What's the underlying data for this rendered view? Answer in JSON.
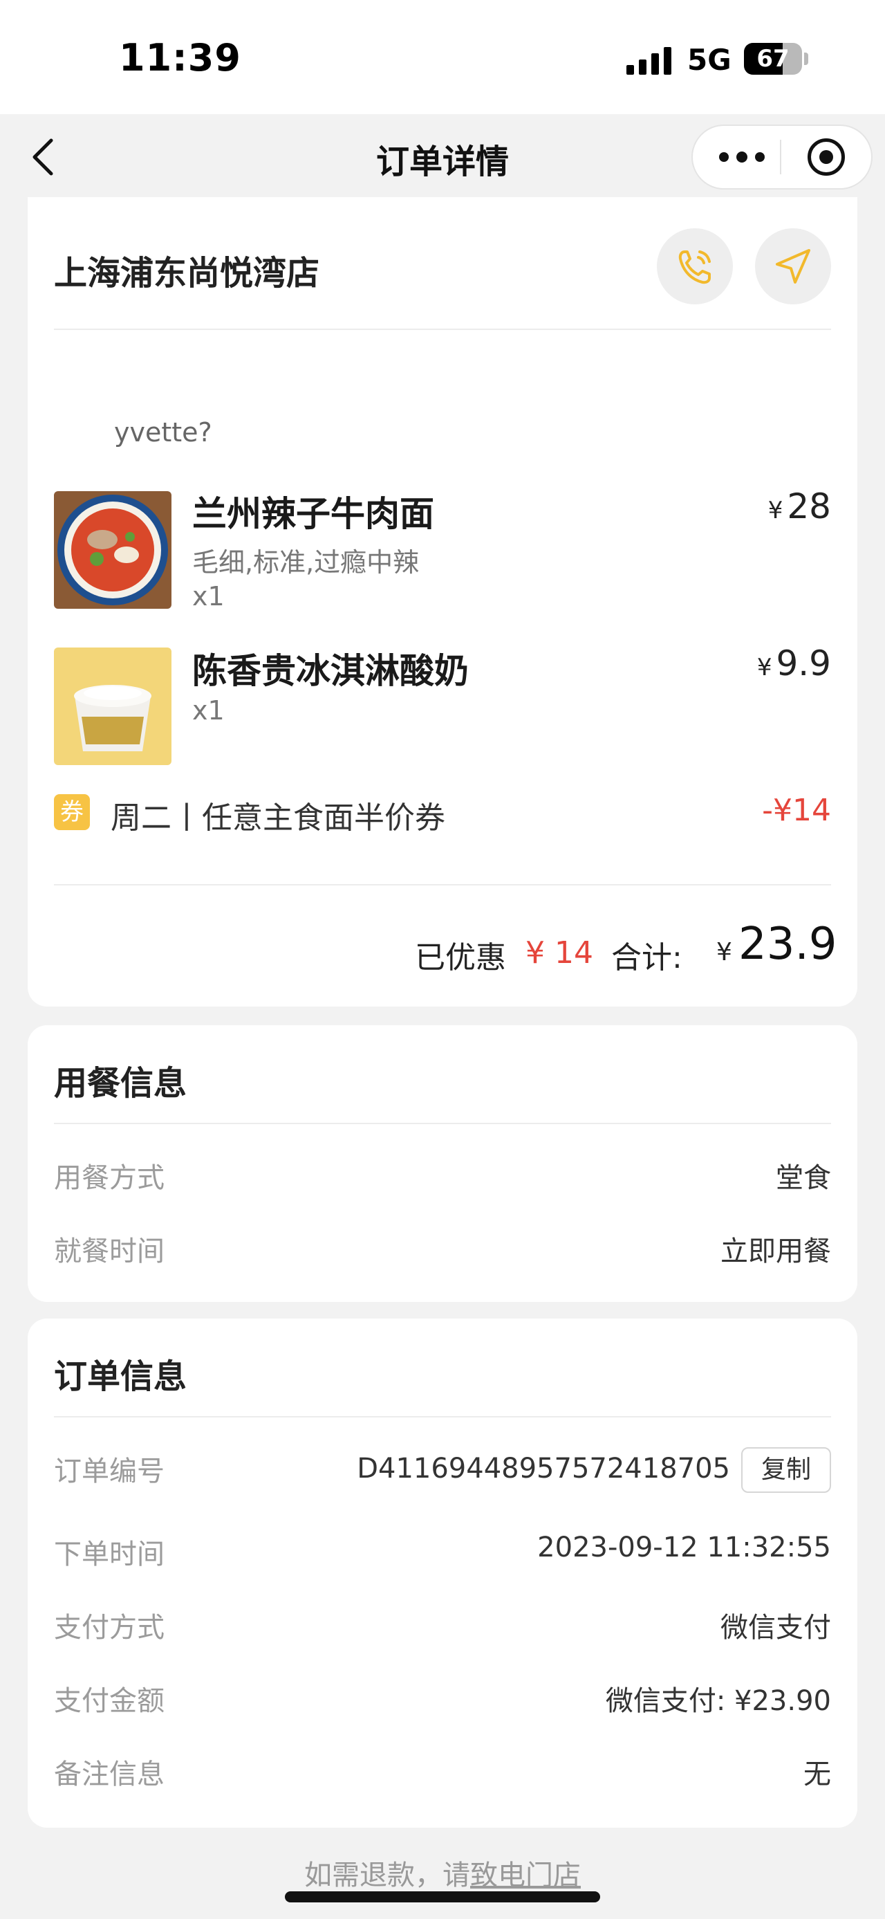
{
  "status_bar": {
    "time": "11:39",
    "network": "5G",
    "battery": "67",
    "battery_level": 0.67
  },
  "nav": {
    "title": "订单详情",
    "back_icon": "chevron-left-icon",
    "more_icon": "more-dots-icon",
    "target_icon": "target-icon"
  },
  "store": {
    "name": "上海浦东尚悦湾店",
    "phone_icon": "phone-icon",
    "navigate_icon": "navigation-arrow-icon",
    "accent_color": "#f7c344"
  },
  "order": {
    "nickname": "yvette?",
    "items": [
      {
        "name": "兰州辣子牛肉面",
        "spec": "毛细,标准,过瘾中辣",
        "qty": "x1",
        "currency": "¥",
        "price": "28"
      },
      {
        "name": "陈香贵冰淇淋酸奶",
        "spec": "",
        "qty": "x1",
        "currency": "¥",
        "price": "9.9"
      }
    ],
    "coupon": {
      "tag": "券",
      "name": "周二丨任意主食面半价券",
      "amount": "-¥14"
    },
    "summary": {
      "saved_label": "已优惠",
      "saved_amount": "¥ 14",
      "total_label": "合计:",
      "total_currency": "¥",
      "total_value": "23.9"
    }
  },
  "dining": {
    "title": "用餐信息",
    "rows": [
      {
        "label": "用餐方式",
        "value": "堂食"
      },
      {
        "label": "就餐时间",
        "value": "立即用餐"
      }
    ]
  },
  "order_info": {
    "title": "订单信息",
    "copy_label": "复制",
    "rows": [
      {
        "label": "订单编号",
        "value": "D41169448957572418705"
      },
      {
        "label": "下单时间",
        "value": "2023-09-12 11:32:55"
      },
      {
        "label": "支付方式",
        "value": "微信支付"
      },
      {
        "label": "支付金额",
        "value": "微信支付: ¥23.90"
      },
      {
        "label": "备注信息",
        "value": "无"
      }
    ]
  },
  "footer": {
    "prefix": "如需退款，请",
    "link": "致电门店"
  }
}
